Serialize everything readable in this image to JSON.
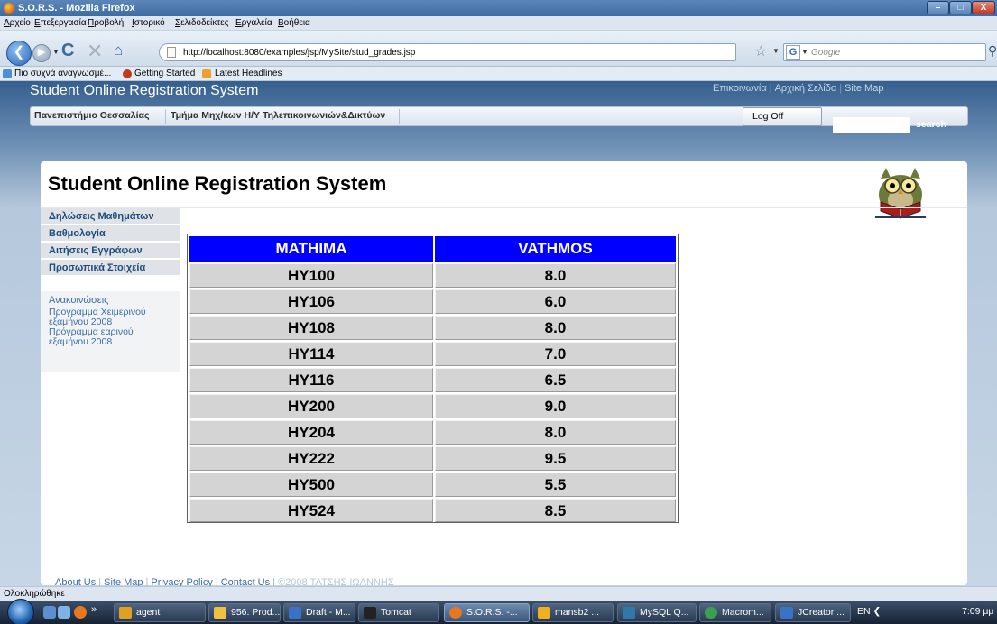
{
  "window": {
    "title": "S.O.R.S. - Mozilla Firefox",
    "controls": {
      "minimize": "–",
      "maximize": "□",
      "close": "X"
    }
  },
  "menu": [
    "Αρχείο",
    "Επεξεργασία",
    "Προβολή",
    "Ιστορικό",
    "Σελιδοδείκτες",
    "Εργαλεία",
    "Βοήθεια"
  ],
  "navigation": {
    "back": "❮",
    "forward": "▶",
    "reload": "C",
    "stop": "✕",
    "home": "⌂",
    "url": "http://localhost:8080/examples/jsp/MySite/stud_grades.jsp",
    "star": "☆",
    "search_engine": "G",
    "search_placeholder": "Google",
    "search_icon": "⚲"
  },
  "bookmarks": [
    "Πιο συχνά αναγνωσμέ...",
    "Getting Started",
    "Latest Headlines"
  ],
  "site": {
    "header_title": "Student Online Registration System",
    "top_links": [
      "Επικοινωνία",
      "Αρχική Σελίδα",
      "Site Map"
    ],
    "tabs": [
      "Πανεπιστήμιο Θεσσαλίας",
      "Τμήμα Μηχ/κων Η/Υ Τηλεπικοινωνιών&Δικτύων"
    ],
    "logoff_label": "Log Off",
    "search_label": "search",
    "heading": "Student Online Registration System"
  },
  "sidebar": {
    "items": [
      "Δηλώσεις Μαθημάτων",
      "Βαθμολογία",
      "Αιτήσεις Εγγράφων",
      "Προσωπικά Στοιχεία"
    ],
    "announcements_title": "Ανακοινώσεις",
    "announcements": [
      "Προγραμμα Χειμερινού",
      "εξαμήνου 2008",
      "Πρόγραμμα εαρινού",
      "εξαμήνου 2008"
    ]
  },
  "grades": {
    "columns": [
      "MATHIMA",
      "VATHMOS"
    ],
    "rows": [
      [
        "HY100",
        "8.0"
      ],
      [
        "HY106",
        "6.0"
      ],
      [
        "HY108",
        "8.0"
      ],
      [
        "HY114",
        "7.0"
      ],
      [
        "HY116",
        "6.5"
      ],
      [
        "HY200",
        "9.0"
      ],
      [
        "HY204",
        "8.0"
      ],
      [
        "HY222",
        "9.5"
      ],
      [
        "HY500",
        "5.5"
      ],
      [
        "HY524",
        "8.5"
      ]
    ]
  },
  "footer": {
    "links": [
      "About Us",
      "Site Map",
      "Privacy Policy",
      "Contact Us"
    ],
    "copyright": "©2008 ΤΑΤΣΗΣ ΙΩΑΝΝΗΣ"
  },
  "status": "Ολοκληρώθηκε",
  "taskbar": {
    "quick_launch_more": "»",
    "buttons": [
      "agent",
      "956. Prod...",
      "Draft - M...",
      "Tomcat",
      "S.O.R.S. -...",
      "mansb2 ...",
      "MySQL Q...",
      "Macrom...",
      "JCreator ..."
    ],
    "active_index": 4,
    "tray": "EN  ❮",
    "clock": "7:09 μμ"
  }
}
